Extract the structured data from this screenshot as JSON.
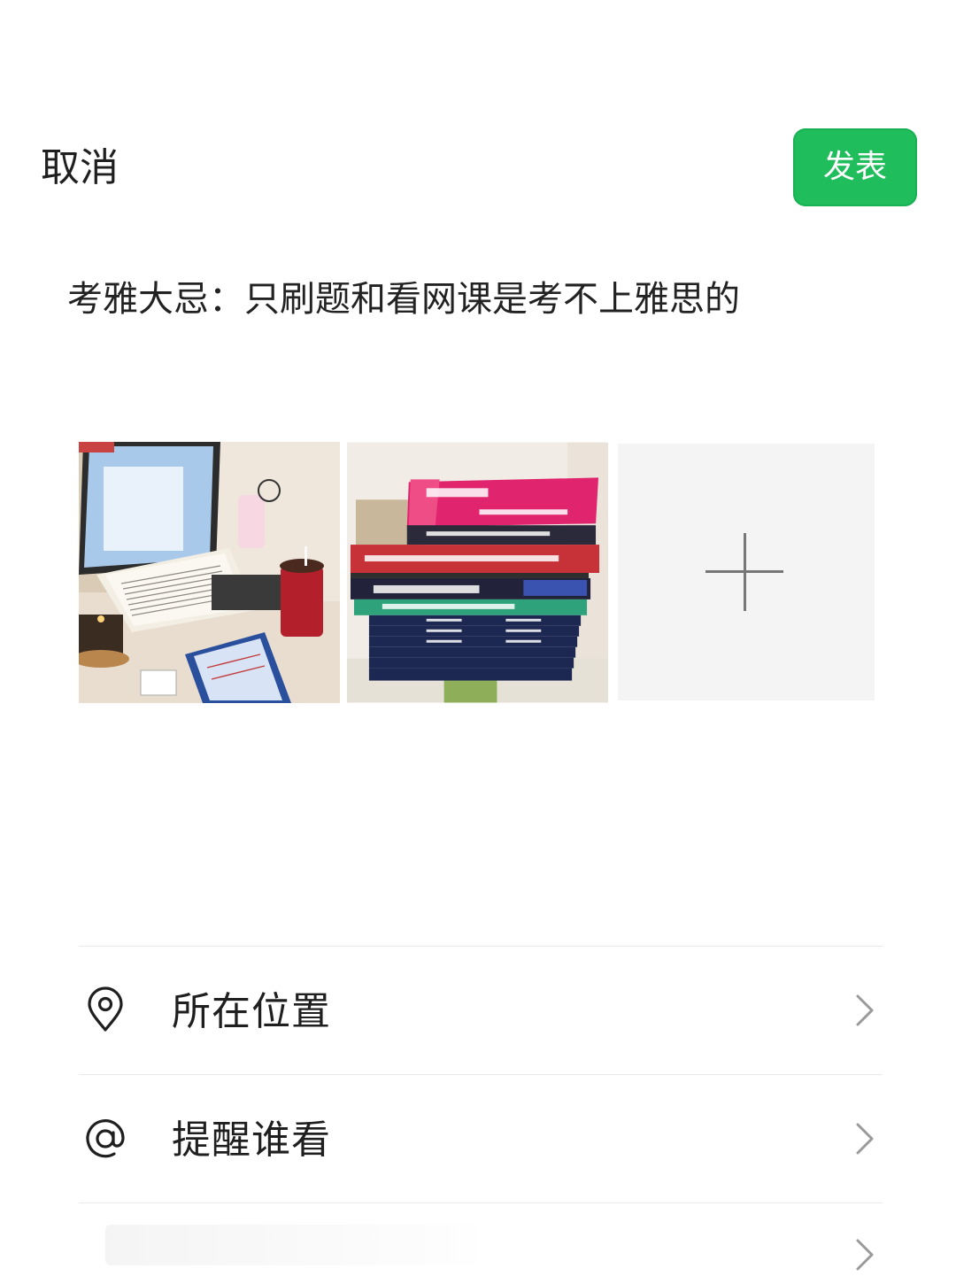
{
  "header": {
    "cancel_label": "取消",
    "publish_label": "发表"
  },
  "post": {
    "text": "考雅大忌：只刷题和看网课是考不上雅思的"
  },
  "photos": {
    "items": [
      {
        "name": "desk-laptop-photo"
      },
      {
        "name": "stacked-books-photo"
      }
    ],
    "add_icon": "plus-icon"
  },
  "options": [
    {
      "label": "所在位置",
      "icon": "location-pin-icon"
    },
    {
      "label": "提醒谁看",
      "icon": "at-sign-icon"
    },
    {
      "label": "",
      "icon": ""
    }
  ],
  "colors": {
    "accent": "#1fbd5b",
    "add_tile_bg": "#f4f4f4",
    "divider": "#e9e9e9"
  }
}
